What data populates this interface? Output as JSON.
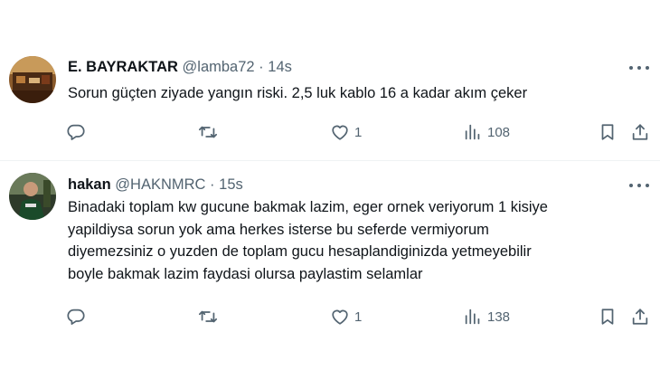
{
  "tweets": [
    {
      "name": "E. BAYRAKTAR",
      "handle": "@lamba72",
      "separator": "·",
      "time": "14s",
      "lines": [
        "Sorun güçten ziyade yangın riski. 2,5 luk kablo 16 a kadar akım çeker"
      ],
      "likes": "1",
      "views": "108"
    },
    {
      "name": "hakan",
      "handle": "@HAKNMRC",
      "separator": "·",
      "time": "15s",
      "lines": [
        "Binadaki toplam  kw gucune bakmak lazim, eger ornek veriyorum 1 kisiye",
        "yapildiysa sorun yok ama herkes isterse bu seferde vermiyorum",
        "diyemezsiniz o yuzden de toplam gucu hesaplandiginizda yetmeyebilir",
        "boyle bakmak lazim faydasi olursa paylastim selamlar"
      ],
      "likes": "1",
      "views": "138"
    }
  ],
  "icons": {
    "reply": "reply-icon",
    "retweet": "retweet-icon",
    "like": "heart-icon",
    "views": "views-icon",
    "bookmark": "bookmark-icon",
    "share": "share-icon",
    "more": "more-icon"
  },
  "colors": {
    "text": "#0f1419",
    "secondary": "#536471",
    "divider": "#eff3f4"
  }
}
